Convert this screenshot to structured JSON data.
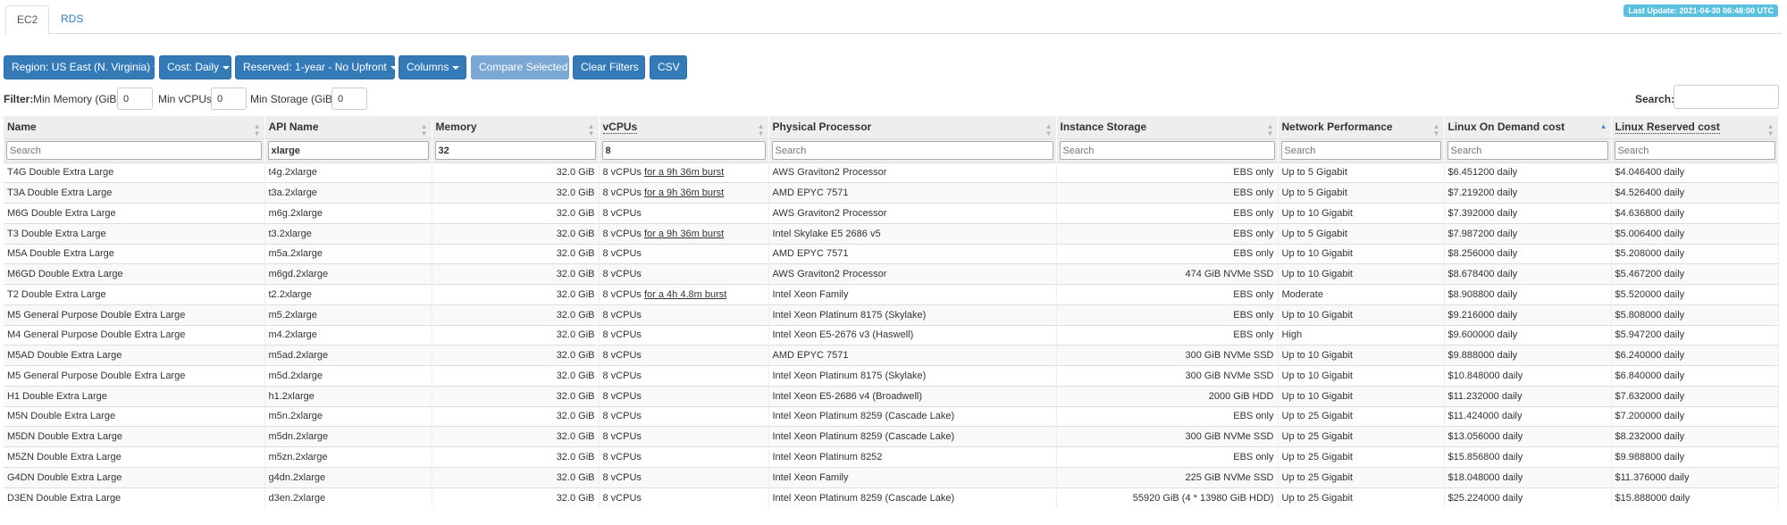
{
  "tabs": [
    {
      "label": "EC2"
    },
    {
      "label": "RDS"
    }
  ],
  "last_update": "Last Update: 2021-04-30 06:48:00 UTC",
  "toolbar": {
    "region": "Region: US East (N. Virginia)",
    "cost": "Cost: Daily",
    "reserved": "Reserved: 1-year - No Upfront",
    "columns": "Columns",
    "compare": "Compare Selected",
    "clear": "Clear Filters",
    "csv": "CSV"
  },
  "filters": {
    "prefix": "Filter:",
    "min_memory_label": "Min Memory (GiB):",
    "min_memory_value": "0",
    "min_vcpus_label": "Min vCPUs:",
    "min_vcpus_value": "0",
    "min_storage_label": "Min Storage (GiB):",
    "min_storage_value": "0",
    "search_label": "Search:",
    "search_value": ""
  },
  "columns": [
    "Name",
    "API Name",
    "Memory",
    "vCPUs",
    "Physical Processor",
    "Instance Storage",
    "Network Performance",
    "Linux On Demand cost",
    "Linux Reserved cost"
  ],
  "column_search": {
    "placeholder": "Search",
    "values": [
      "",
      "xlarge",
      "32",
      "8",
      "",
      "",
      "",
      "",
      ""
    ]
  },
  "rows": [
    {
      "name": "T4G Double Extra Large",
      "api": "t4g.2xlarge",
      "memory": "32.0 GiB",
      "vcpus": "8 vCPUs",
      "burst": "for a 9h 36m burst",
      "processor": "AWS Graviton2 Processor",
      "storage": "EBS only",
      "network": "Up to 5 Gigabit",
      "ondemand": "$6.451200 daily",
      "reserved": "$4.046400 daily"
    },
    {
      "name": "T3A Double Extra Large",
      "api": "t3a.2xlarge",
      "memory": "32.0 GiB",
      "vcpus": "8 vCPUs",
      "burst": "for a 9h 36m burst",
      "processor": "AMD EPYC 7571",
      "storage": "EBS only",
      "network": "Up to 5 Gigabit",
      "ondemand": "$7.219200 daily",
      "reserved": "$4.526400 daily"
    },
    {
      "name": "M6G Double Extra Large",
      "api": "m6g.2xlarge",
      "memory": "32.0 GiB",
      "vcpus": "8 vCPUs",
      "burst": "",
      "processor": "AWS Graviton2 Processor",
      "storage": "EBS only",
      "network": "Up to 10 Gigabit",
      "ondemand": "$7.392000 daily",
      "reserved": "$4.636800 daily"
    },
    {
      "name": "T3 Double Extra Large",
      "api": "t3.2xlarge",
      "memory": "32.0 GiB",
      "vcpus": "8 vCPUs",
      "burst": "for a 9h 36m burst",
      "processor": "Intel Skylake E5 2686 v5",
      "storage": "EBS only",
      "network": "Up to 5 Gigabit",
      "ondemand": "$7.987200 daily",
      "reserved": "$5.006400 daily"
    },
    {
      "name": "M5A Double Extra Large",
      "api": "m5a.2xlarge",
      "memory": "32.0 GiB",
      "vcpus": "8 vCPUs",
      "burst": "",
      "processor": "AMD EPYC 7571",
      "storage": "EBS only",
      "network": "Up to 10 Gigabit",
      "ondemand": "$8.256000 daily",
      "reserved": "$5.208000 daily"
    },
    {
      "name": "M6GD Double Extra Large",
      "api": "m6gd.2xlarge",
      "memory": "32.0 GiB",
      "vcpus": "8 vCPUs",
      "burst": "",
      "processor": "AWS Graviton2 Processor",
      "storage": "474 GiB NVMe SSD",
      "network": "Up to 10 Gigabit",
      "ondemand": "$8.678400 daily",
      "reserved": "$5.467200 daily"
    },
    {
      "name": "T2 Double Extra Large",
      "api": "t2.2xlarge",
      "memory": "32.0 GiB",
      "vcpus": "8 vCPUs",
      "burst": "for a 4h 4.8m burst",
      "processor": "Intel Xeon Family",
      "storage": "EBS only",
      "network": "Moderate",
      "ondemand": "$8.908800 daily",
      "reserved": "$5.520000 daily"
    },
    {
      "name": "M5 General Purpose Double Extra Large",
      "api": "m5.2xlarge",
      "memory": "32.0 GiB",
      "vcpus": "8 vCPUs",
      "burst": "",
      "processor": "Intel Xeon Platinum 8175 (Skylake)",
      "storage": "EBS only",
      "network": "Up to 10 Gigabit",
      "ondemand": "$9.216000 daily",
      "reserved": "$5.808000 daily"
    },
    {
      "name": "M4 General Purpose Double Extra Large",
      "api": "m4.2xlarge",
      "memory": "32.0 GiB",
      "vcpus": "8 vCPUs",
      "burst": "",
      "processor": "Intel Xeon E5-2676 v3 (Haswell)",
      "storage": "EBS only",
      "network": "High",
      "ondemand": "$9.600000 daily",
      "reserved": "$5.947200 daily"
    },
    {
      "name": "M5AD Double Extra Large",
      "api": "m5ad.2xlarge",
      "memory": "32.0 GiB",
      "vcpus": "8 vCPUs",
      "burst": "",
      "processor": "AMD EPYC 7571",
      "storage": "300 GiB NVMe SSD",
      "network": "Up to 10 Gigabit",
      "ondemand": "$9.888000 daily",
      "reserved": "$6.240000 daily"
    },
    {
      "name": "M5 General Purpose Double Extra Large",
      "api": "m5d.2xlarge",
      "memory": "32.0 GiB",
      "vcpus": "8 vCPUs",
      "burst": "",
      "processor": "Intel Xeon Platinum 8175 (Skylake)",
      "storage": "300 GiB NVMe SSD",
      "network": "Up to 10 Gigabit",
      "ondemand": "$10.848000 daily",
      "reserved": "$6.840000 daily"
    },
    {
      "name": "H1 Double Extra Large",
      "api": "h1.2xlarge",
      "memory": "32.0 GiB",
      "vcpus": "8 vCPUs",
      "burst": "",
      "processor": "Intel Xeon E5-2686 v4 (Broadwell)",
      "storage": "2000 GiB HDD",
      "network": "Up to 10 Gigabit",
      "ondemand": "$11.232000 daily",
      "reserved": "$7.632000 daily"
    },
    {
      "name": "M5N Double Extra Large",
      "api": "m5n.2xlarge",
      "memory": "32.0 GiB",
      "vcpus": "8 vCPUs",
      "burst": "",
      "processor": "Intel Xeon Platinum 8259 (Cascade Lake)",
      "storage": "EBS only",
      "network": "Up to 25 Gigabit",
      "ondemand": "$11.424000 daily",
      "reserved": "$7.200000 daily"
    },
    {
      "name": "M5DN Double Extra Large",
      "api": "m5dn.2xlarge",
      "memory": "32.0 GiB",
      "vcpus": "8 vCPUs",
      "burst": "",
      "processor": "Intel Xeon Platinum 8259 (Cascade Lake)",
      "storage": "300 GiB NVMe SSD",
      "network": "Up to 25 Gigabit",
      "ondemand": "$13.056000 daily",
      "reserved": "$8.232000 daily"
    },
    {
      "name": "M5ZN Double Extra Large",
      "api": "m5zn.2xlarge",
      "memory": "32.0 GiB",
      "vcpus": "8 vCPUs",
      "burst": "",
      "processor": "Intel Xeon Platinum 8252",
      "storage": "EBS only",
      "network": "Up to 25 Gigabit",
      "ondemand": "$15.856800 daily",
      "reserved": "$9.988800 daily"
    },
    {
      "name": "G4DN Double Extra Large",
      "api": "g4dn.2xlarge",
      "memory": "32.0 GiB",
      "vcpus": "8 vCPUs",
      "burst": "",
      "processor": "Intel Xeon Family",
      "storage": "225 GiB NVMe SSD",
      "network": "Up to 25 Gigabit",
      "ondemand": "$18.048000 daily",
      "reserved": "$11.376000 daily"
    },
    {
      "name": "D3EN Double Extra Large",
      "api": "d3en.2xlarge",
      "memory": "32.0 GiB",
      "vcpus": "8 vCPUs",
      "burst": "",
      "processor": "Intel Xeon Platinum 8259 (Cascade Lake)",
      "storage": "55920 GiB (4 * 13980 GiB HDD)",
      "network": "Up to 25 Gigabit",
      "ondemand": "$25.224000 daily",
      "reserved": "$15.888000 daily"
    }
  ]
}
